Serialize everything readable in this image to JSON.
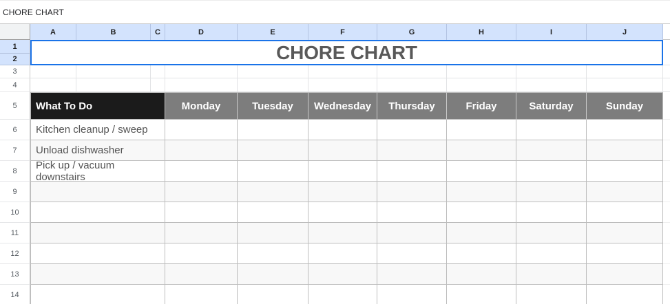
{
  "app": {
    "doc_label": "CHORE CHART"
  },
  "sheet": {
    "column_headers": [
      "A",
      "B",
      "C",
      "D",
      "E",
      "F",
      "G",
      "H",
      "I",
      "J"
    ],
    "row_headers": [
      "1",
      "2",
      "3",
      "4",
      "5",
      "6",
      "7",
      "8",
      "9",
      "10",
      "11",
      "12",
      "13",
      "14"
    ],
    "title": "CHORE CHART",
    "table": {
      "what_to_do_label": "What To Do",
      "days": [
        "Monday",
        "Tuesday",
        "Wednesday",
        "Thursday",
        "Friday",
        "Saturday",
        "Sunday"
      ],
      "chores": [
        "Kitchen cleanup / sweep",
        "Unload dishwasher",
        "Pick up / vacuum downstairs"
      ]
    },
    "colors": {
      "selection_blue": "#1a73e8",
      "selected_header_blue": "#d3e3fd",
      "table_header_black": "#1b1b1b",
      "table_header_gray": "#7d7d7d",
      "banding_gray": "#f8f8f8",
      "title_text_gray": "#595959"
    }
  }
}
